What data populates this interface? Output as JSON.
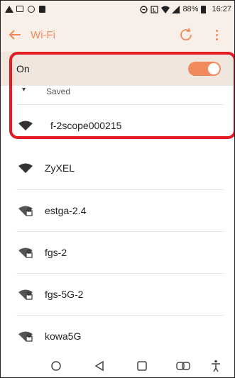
{
  "status_bar": {
    "left_icons": [
      "warning-icon",
      "gallery-icon",
      "circle-icon",
      "shopping-icon"
    ],
    "right_icons": [
      "nfc-icon",
      "lte-icon",
      "wifi-icon",
      "signal-icon",
      "battery-icon"
    ],
    "battery_text": "88%",
    "time": "16:27"
  },
  "app_bar": {
    "title": "Wi-Fi",
    "accent_color": "#f08a5d"
  },
  "wifi_toggle": {
    "label": "On",
    "state": "on"
  },
  "saved_section": {
    "label": "Saved",
    "networks": [
      {
        "name": "f-2scope000215",
        "icon": "wifi-open-icon"
      }
    ]
  },
  "networks": [
    {
      "name": "ZyXEL",
      "icon": "wifi-open-icon"
    },
    {
      "name": "estga-2.4",
      "icon": "wifi-lock-icon"
    },
    {
      "name": "fgs-2",
      "icon": "wifi-lock-icon"
    },
    {
      "name": "fgs-5G-2",
      "icon": "wifi-lock-icon"
    },
    {
      "name": "kowa5G",
      "icon": "wifi-lock-icon"
    }
  ],
  "nav_bar": {
    "items": [
      "home-icon",
      "back-icon",
      "recents-icon",
      "dual-window-icon",
      "accessibility-icon"
    ]
  }
}
